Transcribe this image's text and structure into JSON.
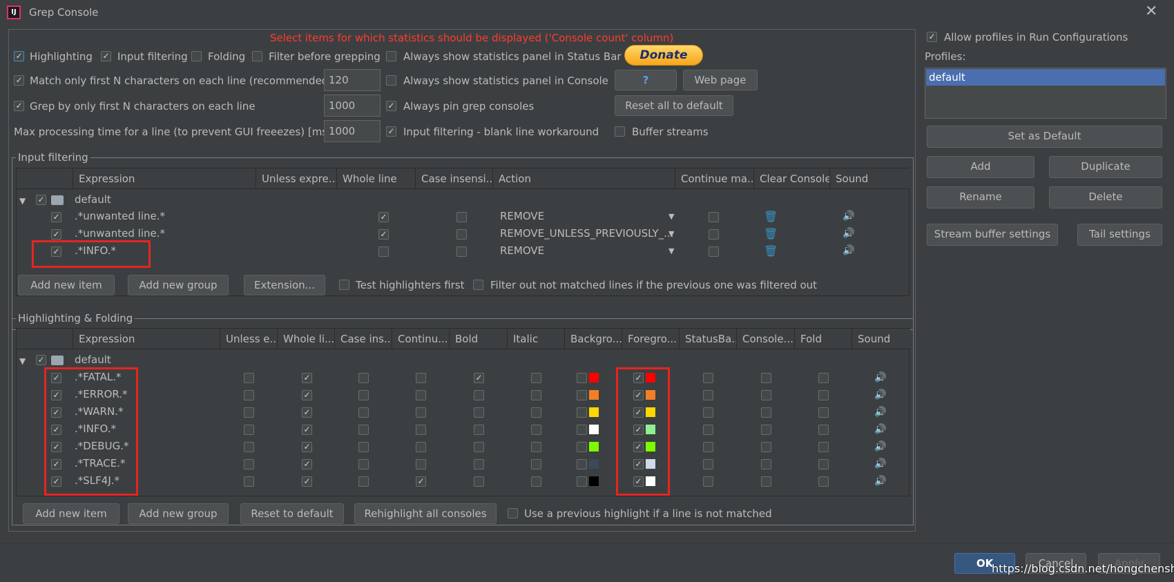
{
  "window": {
    "title": "Grep Console",
    "close_icon": "close-icon"
  },
  "notice": "Select items for which statistics should be displayed ('Console count' column)",
  "options": {
    "highlighting": "Highlighting",
    "input_filtering": "Input filtering",
    "folding": "Folding",
    "filter_before": "Filter before grepping",
    "always_stats_status": "Always show statistics panel in Status Bar",
    "match_first_n": "Match only first N characters on each line (recommended)",
    "match_first_n_value": "120",
    "always_stats_console": "Always show statistics panel in Console",
    "grep_first_n": "Grep by only first N characters on each line",
    "grep_first_n_value": "1000",
    "always_pin": "Always pin grep consoles",
    "max_processing": "Max processing time for a line (to prevent GUI freeezes) [ms]",
    "max_processing_value": "1000",
    "blank_line_workaround": "Input filtering - blank line workaround",
    "buffer_streams": "Buffer streams"
  },
  "buttons": {
    "donate": "Donate",
    "help": "?",
    "web_page": "Web page",
    "reset_all": "Reset all to default"
  },
  "input_filtering": {
    "title": "Input filtering",
    "columns": [
      "Expression",
      "Unless expre...",
      "Whole line",
      "Case insensi...",
      "Action",
      "Continue ma...",
      "Clear Console",
      "Sound"
    ],
    "group": "default",
    "rows": [
      {
        "expr": ".*unwanted line.*",
        "action": "REMOVE"
      },
      {
        "expr": ".*unwanted line.*",
        "action": "REMOVE_UNLESS_PREVIOUSLY_..."
      },
      {
        "expr": ".*INFO.*",
        "action": "REMOVE"
      }
    ],
    "add_item": "Add new item",
    "add_group": "Add new group",
    "extension": "Extension...",
    "test_first": "Test highlighters first",
    "filter_out": "Filter out not matched lines if the previous one was filtered out"
  },
  "highlighting": {
    "title": "Highlighting & Folding",
    "columns": [
      "Expression",
      "Unless e...",
      "Whole li...",
      "Case ins...",
      "Continu...",
      "Bold",
      "Italic",
      "Backgro...",
      "Foregro...",
      "StatusBa...",
      "Console...",
      "Fold",
      "Sound"
    ],
    "group": "default",
    "rows": [
      {
        "expr": ".*FATAL.*",
        "bg": "#ff0000",
        "fg": "#ff0000"
      },
      {
        "expr": ".*ERROR.*",
        "bg": "#f47e25",
        "fg": "#f47e25"
      },
      {
        "expr": ".*WARN.*",
        "bg": "#ffd700",
        "fg": "#ffd700"
      },
      {
        "expr": ".*INFO.*",
        "bg": "#ffffff",
        "fg": "#90ee90"
      },
      {
        "expr": ".*DEBUG.*",
        "bg": "#7cfc00",
        "fg": "#7cfc00"
      },
      {
        "expr": ".*TRACE.*",
        "bg": "#3a4a5a",
        "fg": "#d0d8e8"
      },
      {
        "expr": ".*SLF4J.*",
        "bg": "#000000",
        "fg": "#ffffff"
      }
    ],
    "add_item": "Add new item",
    "add_group": "Add new group",
    "reset": "Reset to default",
    "rehighlight": "Rehighlight all consoles",
    "use_previous": "Use a previous highlight if a line is not matched"
  },
  "profiles": {
    "allow": "Allow profiles in Run Configurations",
    "label": "Profiles:",
    "items": [
      "default"
    ],
    "set_default": "Set as Default",
    "add": "Add",
    "duplicate": "Duplicate",
    "rename": "Rename",
    "delete": "Delete",
    "stream_buffer": "Stream buffer settings",
    "tail": "Tail settings"
  },
  "footer": {
    "ok": "OK",
    "cancel": "Cancel",
    "apply": "Apply"
  },
  "watermark": "https://blog.csdn.net/hongchenshijie",
  "colors": {
    "accent": "#4b6eaf",
    "notice": "#ff3b30",
    "annotation": "#e52521"
  }
}
